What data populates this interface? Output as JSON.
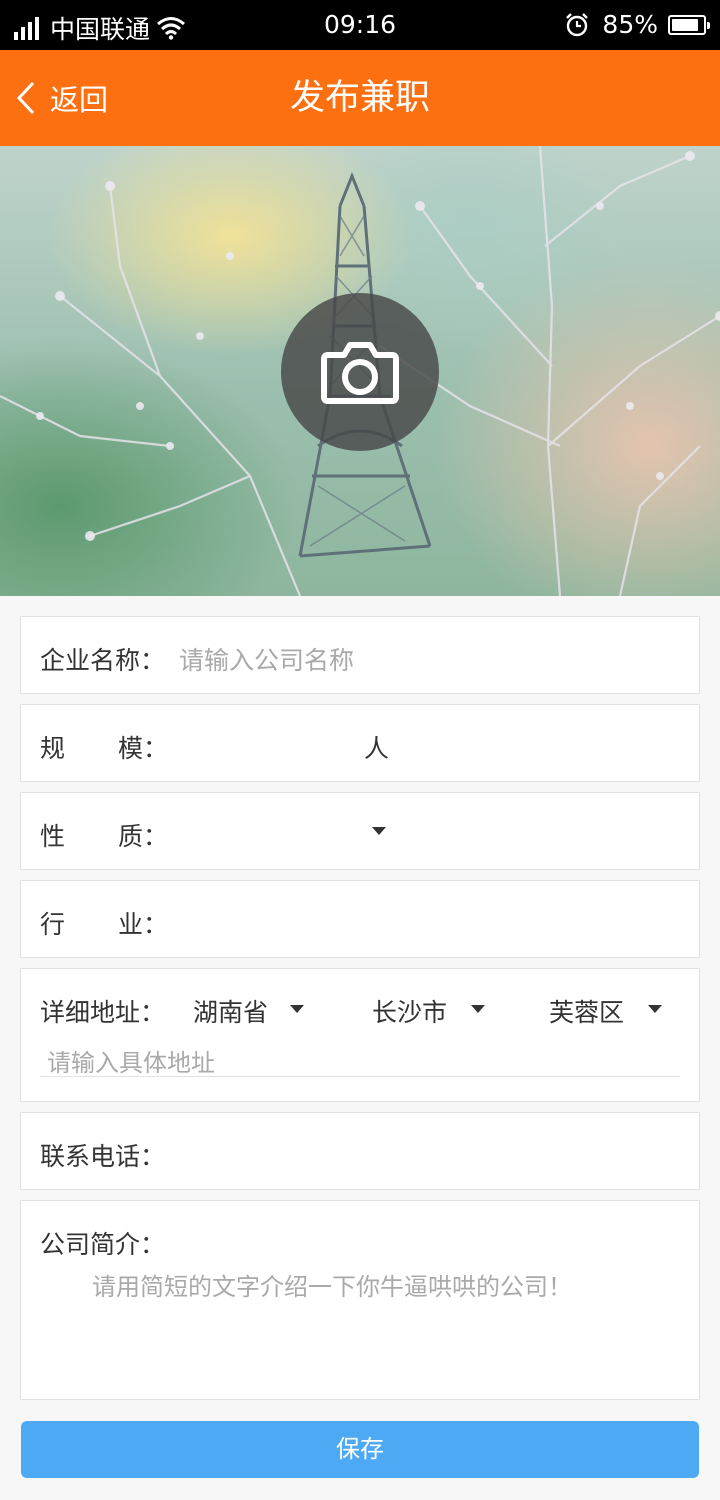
{
  "status_bar": {
    "carrier": "中国联通",
    "time": "09:16",
    "battery_text": "85%",
    "battery_level": 0.85,
    "icons": [
      "signal-icon",
      "wifi-icon",
      "alarm-icon",
      "battery-icon"
    ]
  },
  "nav": {
    "back_label": "返回",
    "title": "发布兼职"
  },
  "banner": {
    "icon": "camera-icon"
  },
  "form": {
    "company_name": {
      "label": "企业名称：",
      "placeholder": "请输入公司名称"
    },
    "scale": {
      "label_a": "规",
      "label_b": "模：",
      "unit": "人"
    },
    "nature": {
      "label_a": "性",
      "label_b": "质："
    },
    "industry": {
      "label_a": "行",
      "label_b": "业："
    },
    "address": {
      "label": "详细地址：",
      "province": "湖南省",
      "city": "长沙市",
      "district": "芙蓉区",
      "placeholder": "请输入具体地址"
    },
    "phone": {
      "label": "联系电话："
    },
    "intro": {
      "label": "公司简介：",
      "placeholder": "请用简短的文字介绍一下你牛逼哄哄的公司！"
    }
  },
  "save_label": "保存",
  "colors": {
    "accent": "#fd7012",
    "button": "#4ea9f4",
    "placeholder": "#a9a9a9"
  }
}
